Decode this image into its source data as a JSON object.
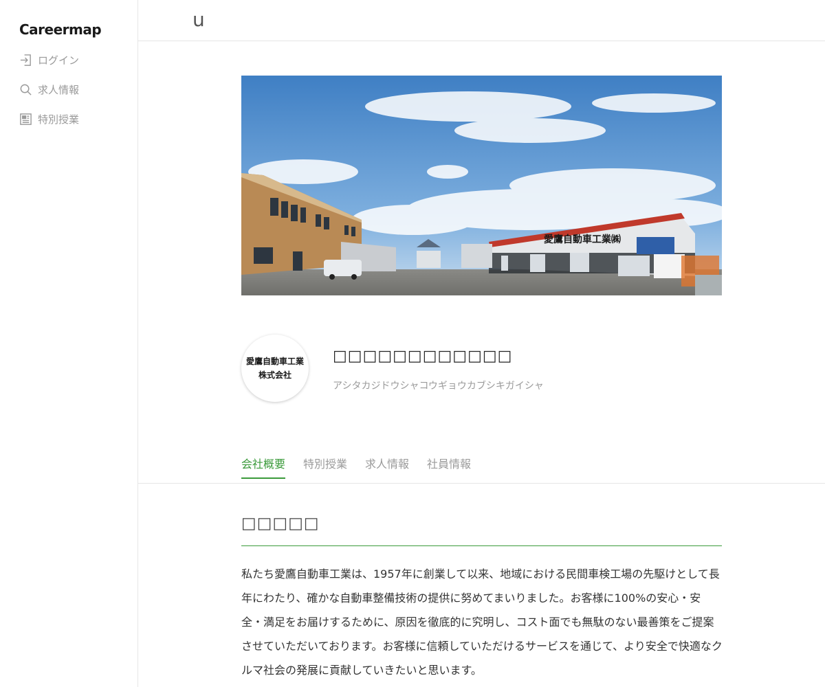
{
  "sidebar": {
    "logo": "Careermap",
    "items": [
      {
        "label": "ログイン",
        "icon": "login-icon"
      },
      {
        "label": "求人情報",
        "icon": "search-icon"
      },
      {
        "label": "特別授業",
        "icon": "newspaper-icon"
      }
    ]
  },
  "topbar": {
    "text": "u"
  },
  "company": {
    "logo_line1": "愛鷹自動車工業",
    "logo_line2": "株式会社",
    "name": "□□□□□□□□□□□□",
    "kana": "アシタカジドウシャコウギョウカブシキガイシャ"
  },
  "tabs": [
    {
      "label": "会社概要",
      "active": true
    },
    {
      "label": "特別授業",
      "active": false
    },
    {
      "label": "求人情報",
      "active": false
    },
    {
      "label": "社員情報",
      "active": false
    }
  ],
  "section": {
    "title": "□□□□□",
    "body": "私たち愛鷹自動車工業は、1957年に創業して以来、地域における民間車検工場の先駆けとして長年にわたり、確かな自動車整備技術の提供に努めてまいりました。お客様に100%の安心・安全・満足をお届けするために、原因を徹底的に究明し、コスト面でも無駄のない最善策をご提案させていただいております。お客様に信頼していただけるサービスを通じて、より安全で快適なクルマ社会の発展に貢献していきたいと思います。"
  },
  "hero": {
    "sign_text": "愛鷹自動車工業㈱",
    "colors": {
      "sky_top": "#3f7fc4",
      "sky_bottom": "#a9cdea",
      "building_left": "#b98a55",
      "roof": "#c0392b"
    }
  },
  "colors": {
    "accent": "#3a9a3a",
    "muted": "#9a9a9a"
  }
}
